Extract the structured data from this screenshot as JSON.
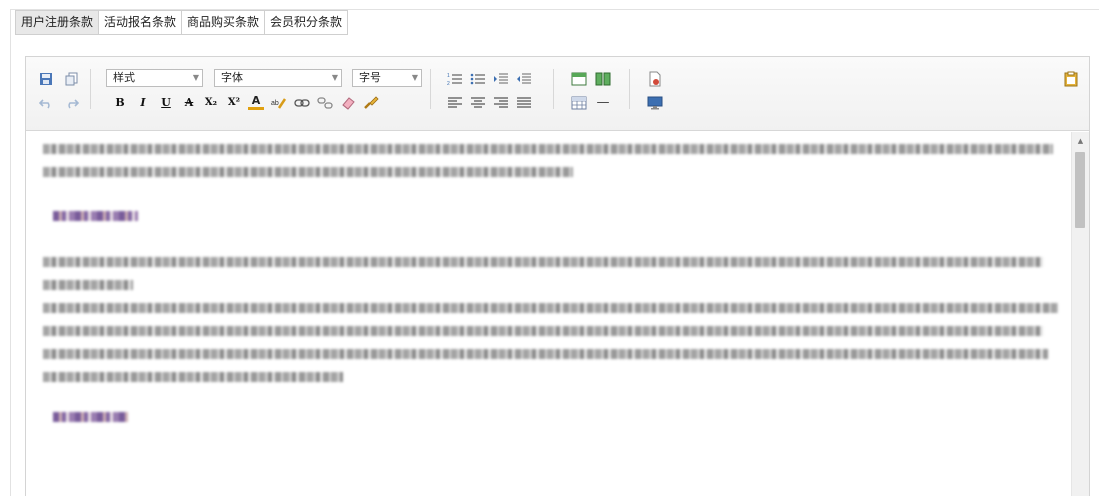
{
  "tabs": [
    {
      "label": "用户注册条款",
      "active": true
    },
    {
      "label": "活动报名条款",
      "active": false
    },
    {
      "label": "商品购买条款",
      "active": false
    },
    {
      "label": "会员积分条款",
      "active": false
    }
  ],
  "toolbar": {
    "style_combo": "样式",
    "font_combo": "字体",
    "size_combo": "字号",
    "bold_label": "B",
    "italic_label": "I",
    "underline_label": "U",
    "strike_label": "A",
    "subscript_label": "X₂",
    "superscript_label": "X²",
    "font_color_label": "A",
    "horizontal_rule_label": "—"
  },
  "colors": {
    "tab_active_bg": "#e8e8e8",
    "toolbar_bg": "#f3f3f3",
    "icon_blue": "#3c6fb1",
    "icon_orange": "#d9a521"
  }
}
